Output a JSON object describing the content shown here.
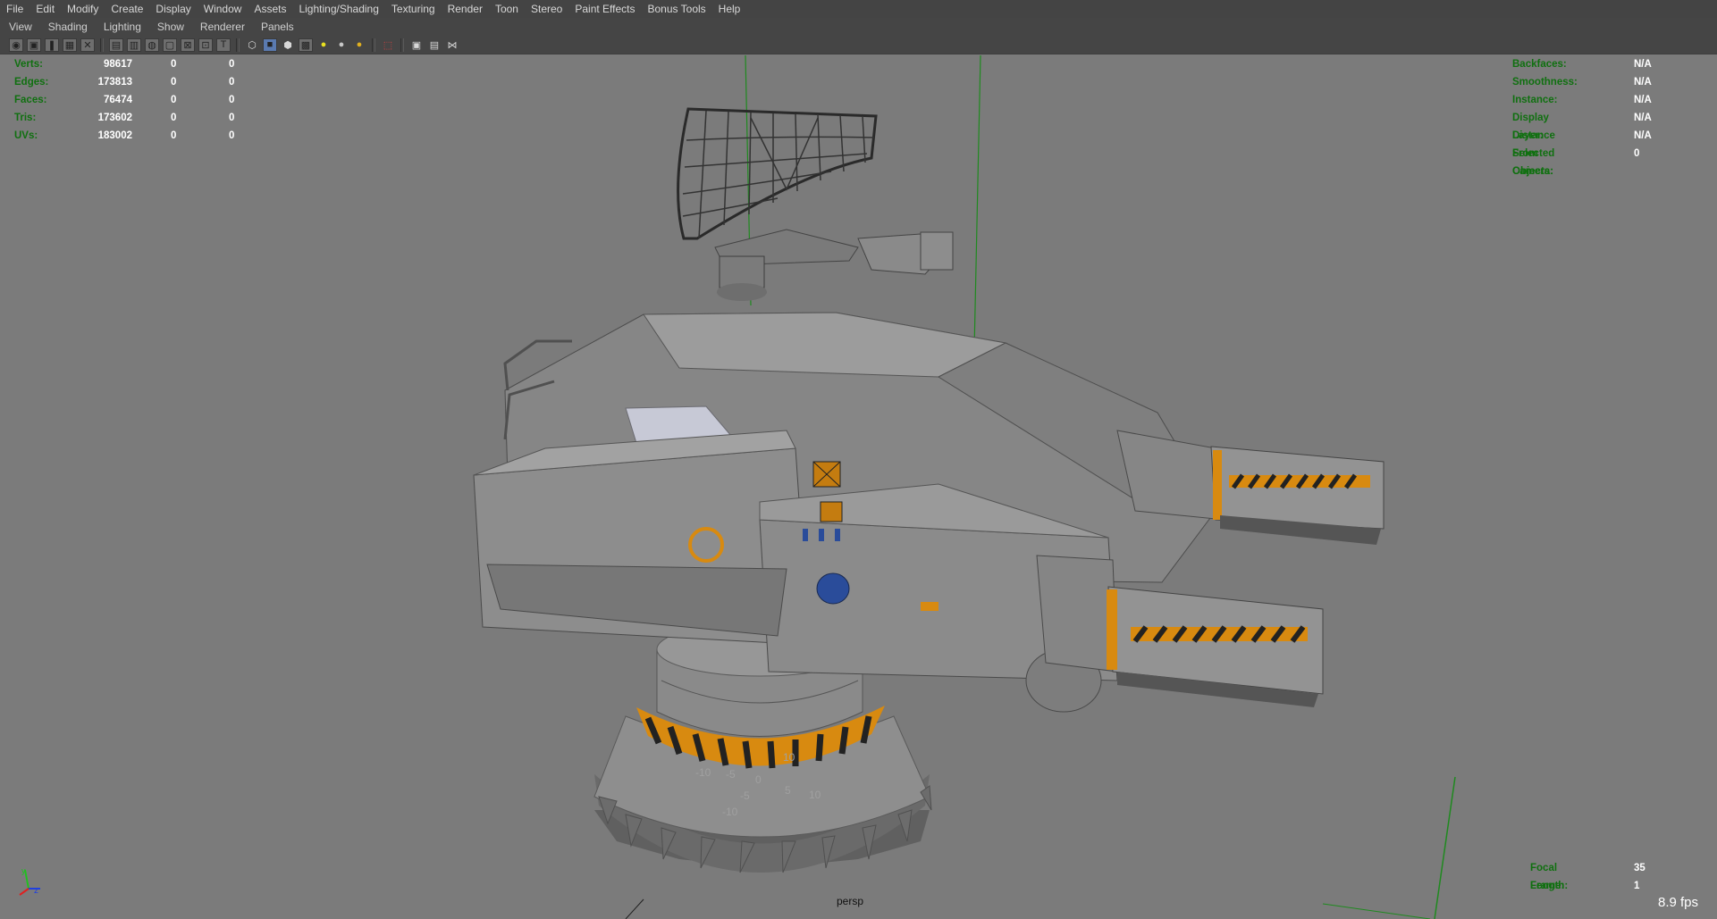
{
  "menubar": {
    "items": [
      "File",
      "Edit",
      "Modify",
      "Create",
      "Display",
      "Window",
      "Assets",
      "Lighting/Shading",
      "Texturing",
      "Render",
      "Toon",
      "Stereo",
      "Paint Effects",
      "Bonus Tools",
      "Help"
    ]
  },
  "panel_menu": {
    "items": [
      "View",
      "Shading",
      "Lighting",
      "Show",
      "Renderer",
      "Panels"
    ]
  },
  "toolbar": {
    "icons": [
      "camera-select-icon",
      "camera-attributes-icon",
      "bookmark-icon",
      "image-plane-icon",
      "grid-icon",
      "film-gate-icon",
      "resolution-gate-icon",
      "gate-mask-icon",
      "field-chart-icon",
      "safe-action-icon",
      "safe-title-icon",
      "wireframe-icon",
      "smooth-shade-icon",
      "default-material-icon",
      "textured-icon",
      "use-all-lights-icon",
      "shadows-icon",
      "ambient-occlusion-icon",
      "isolate-select-icon",
      "xray-icon",
      "xray-joints-icon",
      "component-display-icon"
    ]
  },
  "hud_left": {
    "rows": [
      {
        "label": "Verts:",
        "values": [
          "98617",
          "0",
          "0"
        ]
      },
      {
        "label": "Edges:",
        "values": [
          "173813",
          "0",
          "0"
        ]
      },
      {
        "label": "Faces:",
        "values": [
          "76474",
          "0",
          "0"
        ]
      },
      {
        "label": "Tris:",
        "values": [
          "173602",
          "0",
          "0"
        ]
      },
      {
        "label": "UVs:",
        "values": [
          "183002",
          "0",
          "0"
        ]
      }
    ]
  },
  "hud_right": {
    "rows": [
      {
        "label": "Backfaces:",
        "value": "N/A"
      },
      {
        "label": "Smoothness:",
        "value": "N/A"
      },
      {
        "label": "Instance:",
        "value": "N/A"
      },
      {
        "label": "Display Layer:",
        "value": "N/A"
      },
      {
        "label": "Distance From Camera:",
        "value": "N/A"
      },
      {
        "label": "Selected Objects:",
        "value": "0"
      }
    ]
  },
  "hud_bottom_right": {
    "rows": [
      {
        "label": "Focal Length:",
        "value": "35"
      },
      {
        "label": "Frame:",
        "value": "1"
      }
    ]
  },
  "camera_name": "persp",
  "fps": "8.9 fps",
  "axis": {
    "y": "y",
    "z": "z"
  },
  "grid_labels": [
    "-10",
    "-5",
    "0",
    "5",
    "10",
    "10",
    "-5",
    "-10"
  ],
  "colors": {
    "viewport_bg": "#7b7b7b",
    "hud_label": "#0f6a0f",
    "model_grey": "#8a8a8a",
    "hazard_orange": "#d88a10",
    "accent_blue": "#2a4c9a"
  }
}
